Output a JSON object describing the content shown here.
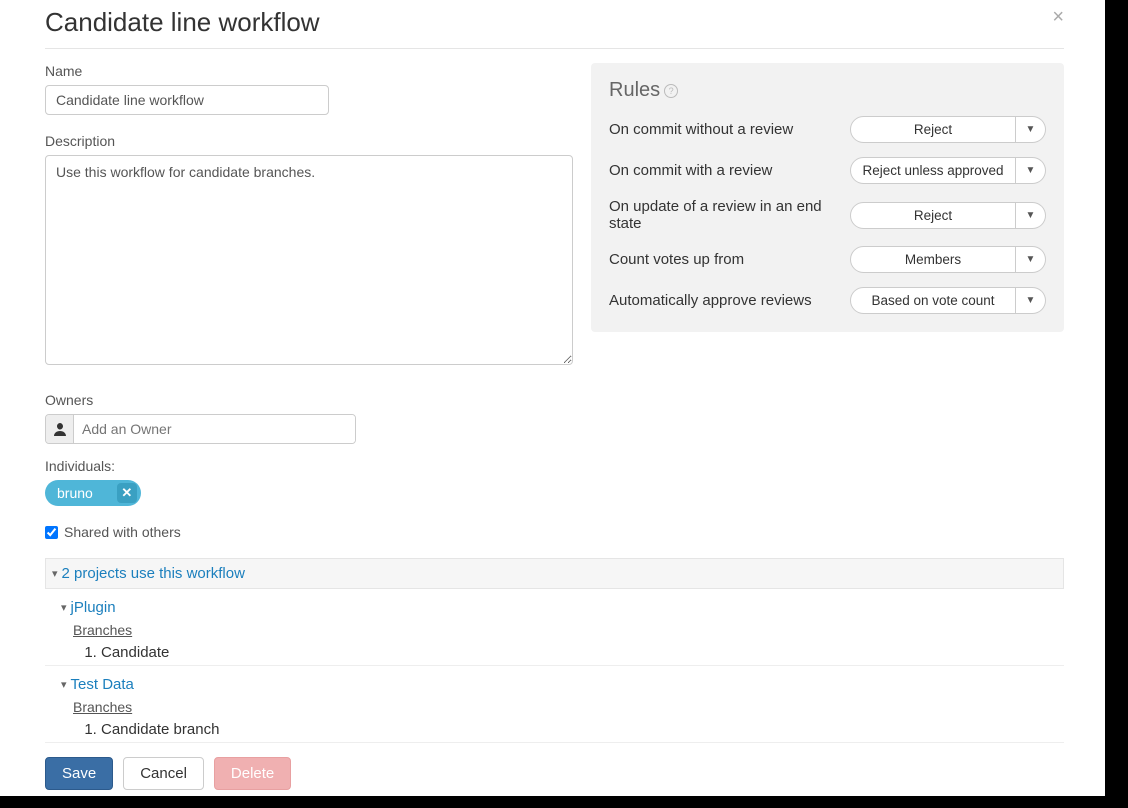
{
  "header": {
    "title": "Candidate line workflow",
    "close": "×"
  },
  "form": {
    "name_label": "Name",
    "name_value": "Candidate line workflow",
    "desc_label": "Description",
    "desc_value": "Use this workflow for candidate branches.",
    "owners_label": "Owners",
    "owners_placeholder": "Add an Owner",
    "individuals_label": "Individuals:",
    "individuals": [
      {
        "name": "bruno"
      }
    ],
    "shared_label": "Shared with others",
    "shared_checked": true
  },
  "rules": {
    "title": "Rules",
    "items": [
      {
        "label": "On commit without a review",
        "value": "Reject"
      },
      {
        "label": "On commit with a review",
        "value": "Reject unless approved"
      },
      {
        "label": "On update of a review in an end state",
        "value": "Reject"
      },
      {
        "label": "Count votes up from",
        "value": "Members"
      },
      {
        "label": "Automatically approve reviews",
        "value": "Based on vote count"
      }
    ]
  },
  "projects": {
    "summary": "2 projects use this workflow",
    "branches_label": "Branches",
    "items": [
      {
        "name": "jPlugin",
        "branches": [
          "Candidate"
        ]
      },
      {
        "name": "Test Data",
        "branches": [
          "Candidate branch"
        ]
      }
    ]
  },
  "buttons": {
    "save": "Save",
    "cancel": "Cancel",
    "delete": "Delete"
  }
}
